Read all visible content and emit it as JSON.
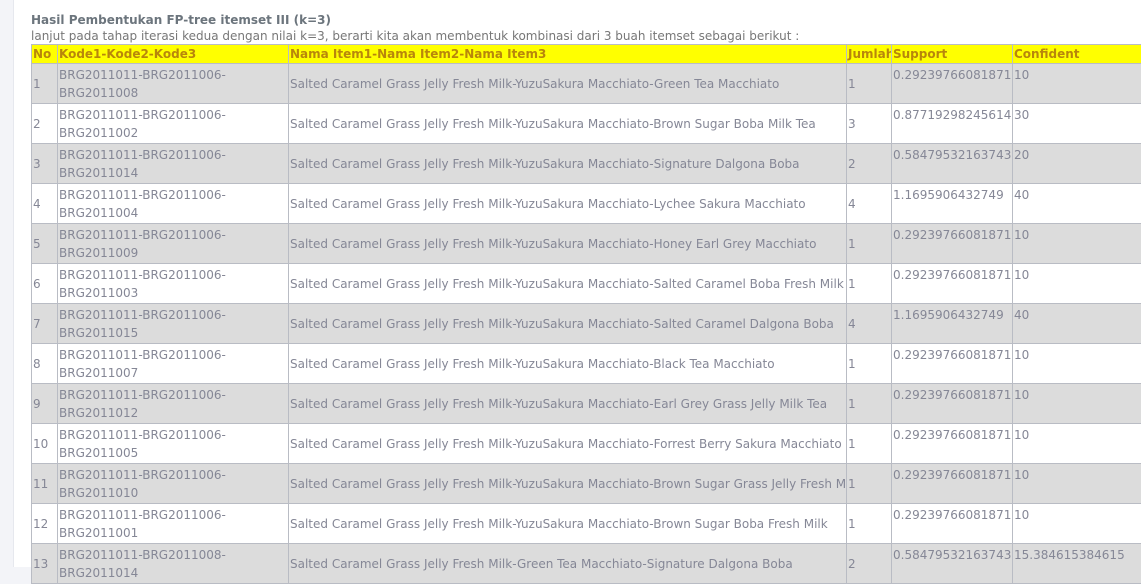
{
  "heading": "Hasil Pembentukan FP-tree itemset III (k=3)",
  "subtitle": "lanjut pada tahap iterasi kedua dengan nilai k=3, berarti kita akan membentuk kombinasi dari 3 buah itemset sebagai berikut :",
  "table": {
    "headers": [
      "No",
      "Kode1-Kode2-Kode3",
      "Nama Item1-Nama Item2-Nama Item3",
      "Jumlah",
      "Support",
      "Confident"
    ],
    "rows": [
      {
        "no": "1",
        "kode": "BRG2011011-BRG2011006-BRG2011008",
        "nama": "Salted Caramel Grass Jelly Fresh Milk-YuzuSakura Macchiato-Green Tea Macchiato",
        "jumlah": "1",
        "support": "0.29239766081871",
        "confident": "10"
      },
      {
        "no": "2",
        "kode": "BRG2011011-BRG2011006-BRG2011002",
        "nama": "Salted Caramel Grass Jelly Fresh Milk-YuzuSakura Macchiato-Brown Sugar Boba Milk Tea",
        "jumlah": "3",
        "support": "0.87719298245614",
        "confident": "30"
      },
      {
        "no": "3",
        "kode": "BRG2011011-BRG2011006-BRG2011014",
        "nama": "Salted Caramel Grass Jelly Fresh Milk-YuzuSakura Macchiato-Signature Dalgona Boba",
        "jumlah": "2",
        "support": "0.58479532163743",
        "confident": "20"
      },
      {
        "no": "4",
        "kode": "BRG2011011-BRG2011006-BRG2011004",
        "nama": "Salted Caramel Grass Jelly Fresh Milk-YuzuSakura Macchiato-Lychee Sakura Macchiato",
        "jumlah": "4",
        "support": "1.1695906432749",
        "confident": "40"
      },
      {
        "no": "5",
        "kode": "BRG2011011-BRG2011006-BRG2011009",
        "nama": "Salted Caramel Grass Jelly Fresh Milk-YuzuSakura Macchiato-Honey Earl Grey Macchiato",
        "jumlah": "1",
        "support": "0.29239766081871",
        "confident": "10"
      },
      {
        "no": "6",
        "kode": "BRG2011011-BRG2011006-BRG2011003",
        "nama": "Salted Caramel Grass Jelly Fresh Milk-YuzuSakura Macchiato-Salted Caramel Boba Fresh Milk",
        "jumlah": "1",
        "support": "0.29239766081871",
        "confident": "10"
      },
      {
        "no": "7",
        "kode": "BRG2011011-BRG2011006-BRG2011015",
        "nama": "Salted Caramel Grass Jelly Fresh Milk-YuzuSakura Macchiato-Salted Caramel Dalgona Boba",
        "jumlah": "4",
        "support": "1.1695906432749",
        "confident": "40"
      },
      {
        "no": "8",
        "kode": "BRG2011011-BRG2011006-BRG2011007",
        "nama": "Salted Caramel Grass Jelly Fresh Milk-YuzuSakura Macchiato-Black Tea Macchiato",
        "jumlah": "1",
        "support": "0.29239766081871",
        "confident": "10"
      },
      {
        "no": "9",
        "kode": "BRG2011011-BRG2011006-BRG2011012",
        "nama": "Salted Caramel Grass Jelly Fresh Milk-YuzuSakura Macchiato-Earl Grey Grass Jelly Milk Tea",
        "jumlah": "1",
        "support": "0.29239766081871",
        "confident": "10"
      },
      {
        "no": "10",
        "kode": "BRG2011011-BRG2011006-BRG2011005",
        "nama": "Salted Caramel Grass Jelly Fresh Milk-YuzuSakura Macchiato-Forrest Berry Sakura Macchiato",
        "jumlah": "1",
        "support": "0.29239766081871",
        "confident": "10"
      },
      {
        "no": "11",
        "kode": "BRG2011011-BRG2011006-BRG2011010",
        "nama": "Salted Caramel Grass Jelly Fresh Milk-YuzuSakura Macchiato-Brown Sugar Grass Jelly Fresh Milk",
        "jumlah": "1",
        "support": "0.29239766081871",
        "confident": "10"
      },
      {
        "no": "12",
        "kode": "BRG2011011-BRG2011006-BRG2011001",
        "nama": "Salted Caramel Grass Jelly Fresh Milk-YuzuSakura Macchiato-Brown Sugar Boba Fresh Milk",
        "jumlah": "1",
        "support": "0.29239766081871",
        "confident": "10"
      },
      {
        "no": "13",
        "kode": "BRG2011011-BRG2011008-BRG2011014",
        "nama": "Salted Caramel Grass Jelly Fresh Milk-Green Tea Macchiato-Signature Dalgona Boba",
        "jumlah": "2",
        "support": "0.58479532163743",
        "confident": "15.384615384615"
      }
    ]
  },
  "colors": {
    "header_bg": "#ffff00",
    "header_text": "#b8860b",
    "odd_row_bg": "#dcdcdc",
    "even_row_bg": "#ffffff"
  }
}
